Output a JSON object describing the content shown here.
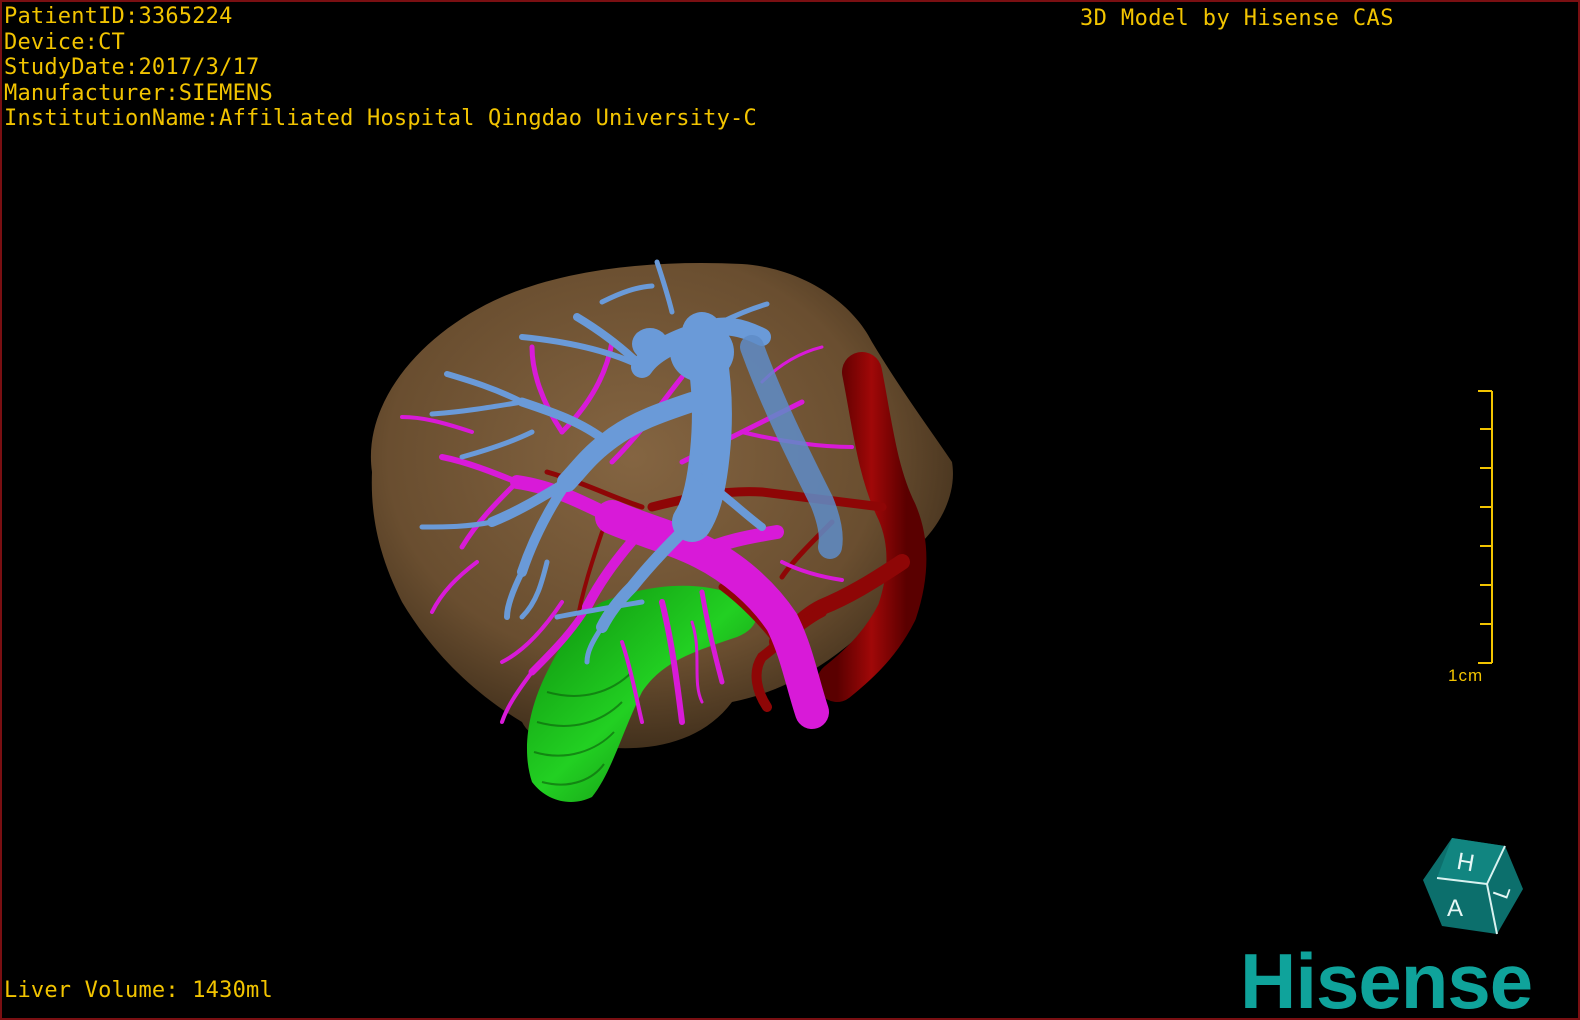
{
  "header": {
    "patient_id": "PatientID:3365224",
    "device": "Device:CT",
    "study_date": "StudyDate:2017/3/17",
    "manufacturer": "Manufacturer:SIEMENS",
    "institution": "InstitutionName:Affiliated Hospital Qingdao University-C"
  },
  "credit": "3D Model by Hisense CAS",
  "footer": {
    "liver_volume": "Liver Volume: 1430ml"
  },
  "scale_bar": {
    "label": "1cm",
    "color": "#f2c400"
  },
  "orientation_cube": {
    "face_top": "H",
    "face_left": "A",
    "face_right": "L",
    "color": "#0c6f6c"
  },
  "brand": {
    "logo_text": "Hisense",
    "color": "#0fa39b"
  },
  "model_colors": {
    "liver": "#7a5a3a",
    "hepatic_vein": "#6a9ad8",
    "portal_vein": "#d81ad8",
    "artery": "#8e0606",
    "gallbladder_duct": "#18b818"
  }
}
